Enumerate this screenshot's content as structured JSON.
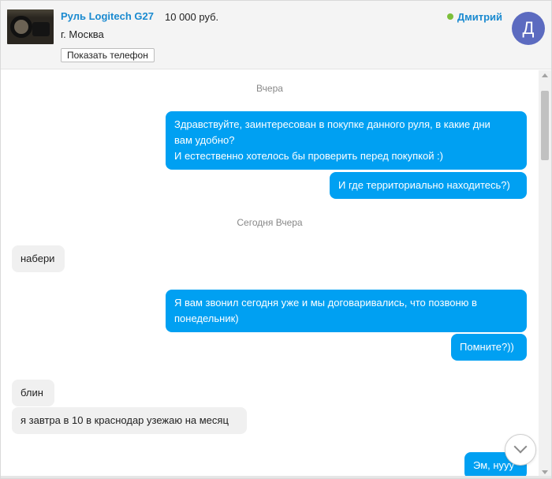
{
  "listing": {
    "title": "Руль Logitech G27",
    "price": "10 000 руб.",
    "city": "г. Москва",
    "show_phone_label": "Показать телефон",
    "thumbnail_icon": "product-photo"
  },
  "user": {
    "name": "Дмитрий",
    "avatar_letter": "Д",
    "status": "online",
    "avatar_color": "#5c6bc0",
    "status_color": "#7cbf3a"
  },
  "colors": {
    "accent": "#1a8ad0",
    "outgoing_bubble": "#00a0f2",
    "incoming_bubble": "#f0f0f0"
  },
  "chat": {
    "dividers": [
      "Вчера",
      "Сегодня Вчера"
    ],
    "messages": [
      {
        "dir": "out",
        "lines": [
          "Здравствуйте, заинтересован в покупке данного руля, в какие дни",
          "вам удобно?",
          "И естественно хотелось бы проверить  перед покупкой :)"
        ]
      },
      {
        "dir": "out",
        "lines": [
          "И где территориально находитесь?)"
        ]
      },
      {
        "dir": "in",
        "lines": [
          "набери"
        ]
      },
      {
        "dir": "out",
        "lines": [
          "Я вам звонил сегодня уже и мы договаривались, что позвоню в",
          "понедельник)"
        ]
      },
      {
        "dir": "out",
        "lines": [
          "Помните?))"
        ]
      },
      {
        "dir": "in",
        "lines": [
          "блин"
        ]
      },
      {
        "dir": "in",
        "lines": [
          "я завтра в 10 в краснодар узежаю на месяц"
        ]
      },
      {
        "dir": "out",
        "lines": [
          "Эм, нууу"
        ]
      }
    ]
  },
  "icons": {
    "scroll_down_button": "chevron-down-icon",
    "scroll_up_arrow": "arrow-up-icon",
    "scroll_down_arrow": "arrow-down-icon"
  }
}
